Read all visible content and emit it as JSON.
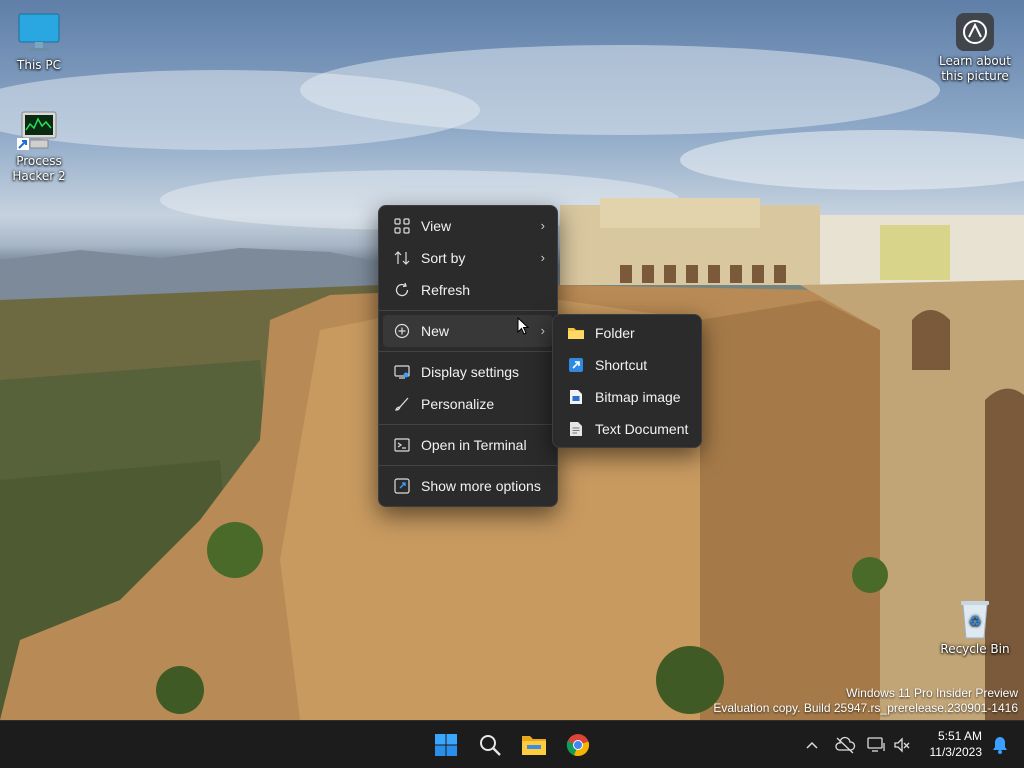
{
  "desktop": {
    "icons": [
      {
        "label": "This PC"
      },
      {
        "label_line1": "Process",
        "label_line2": "Hacker 2"
      },
      {
        "label": "Recycle Bin"
      }
    ],
    "spotlight": {
      "line1": "Learn about",
      "line2": "this picture"
    },
    "watermark": {
      "line1": "Windows 11 Pro Insider Preview",
      "line2": "Evaluation copy. Build 25947.rs_prerelease.230901-1416"
    }
  },
  "context_menu": {
    "items": [
      {
        "label": "View",
        "icon": "grid-icon",
        "has_submenu": true
      },
      {
        "label": "Sort by",
        "icon": "sort-icon",
        "has_submenu": true
      },
      {
        "label": "Refresh",
        "icon": "refresh-icon"
      },
      {
        "label": "New",
        "icon": "plus-circle-icon",
        "has_submenu": true
      },
      {
        "label": "Display settings",
        "icon": "display-icon"
      },
      {
        "label": "Personalize",
        "icon": "brush-icon"
      },
      {
        "label": "Open in Terminal",
        "icon": "terminal-icon"
      },
      {
        "label": "Show more options",
        "icon": "expand-icon"
      }
    ]
  },
  "new_submenu": {
    "items": [
      {
        "label": "Folder",
        "icon": "folder-icon"
      },
      {
        "label": "Shortcut",
        "icon": "shortcut-icon"
      },
      {
        "label": "Bitmap image",
        "icon": "bitmap-icon"
      },
      {
        "label": "Text Document",
        "icon": "text-document-icon"
      }
    ]
  },
  "taskbar": {
    "clock": {
      "time": "5:51 AM",
      "date": "11/3/2023"
    },
    "apps": [
      "start-icon",
      "search-icon",
      "file-explorer-icon",
      "chrome-icon"
    ]
  },
  "colors": {
    "menu_bg": "#2b2b2b",
    "accent": "#0a84ff",
    "folder": "#f4c542"
  }
}
